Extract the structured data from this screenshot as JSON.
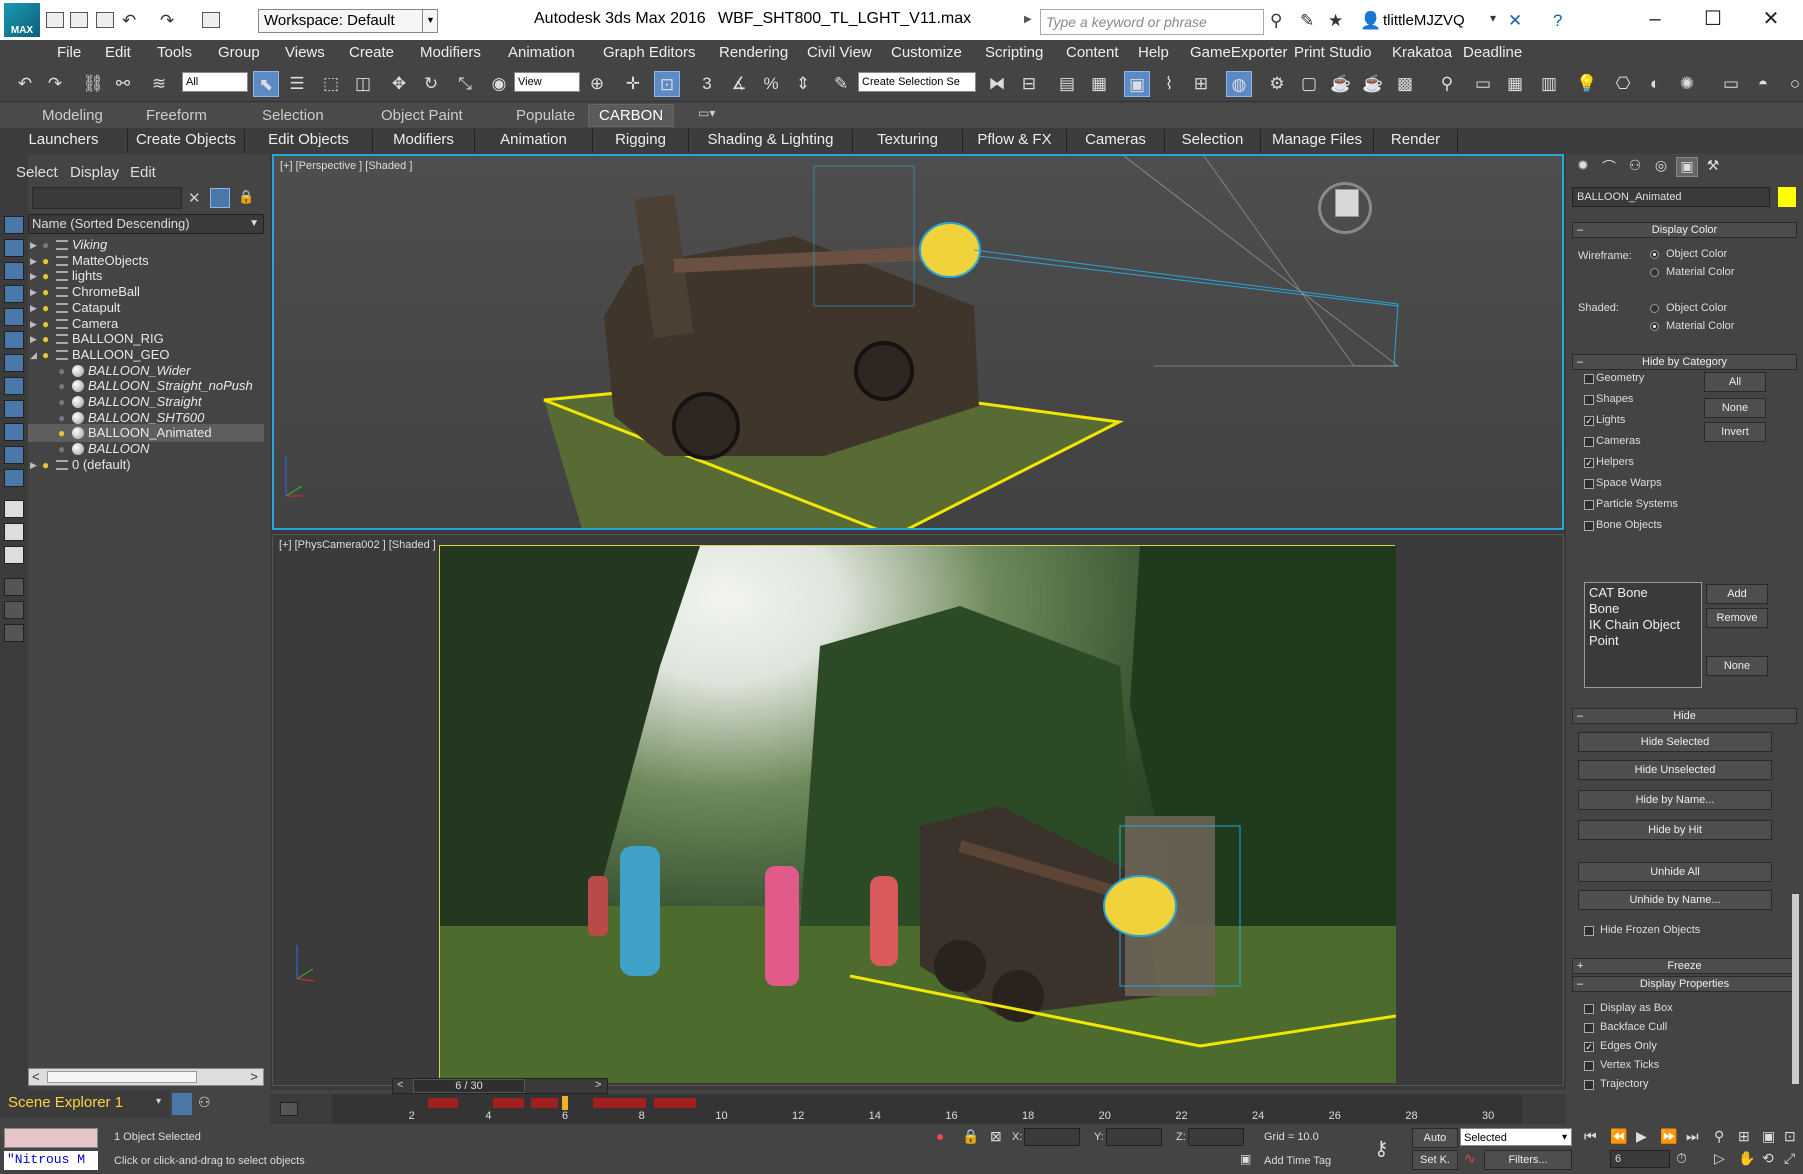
{
  "titlebar": {
    "app_title": "Autodesk 3ds Max 2016",
    "file_title": "WBF_SHT800_TL_LGHT_V11.max",
    "workspace": "Workspace: Default",
    "search_placeholder": "Type a keyword or phrase",
    "user": "tlittleMJZVQ",
    "logo_text": "MAX"
  },
  "menubar": [
    "File",
    "Edit",
    "Tools",
    "Group",
    "Views",
    "Create",
    "Modifiers",
    "Animation",
    "Graph Editors",
    "Rendering",
    "Civil View",
    "Customize",
    "Scripting",
    "Content",
    "Help",
    "GameExporter",
    "Print Studio",
    "Krakatoa",
    "Deadline"
  ],
  "toolbar": {
    "selection_filter": "All",
    "ref_coord": "View",
    "named_selection": "Create Selection Se"
  },
  "ribbon_tabs": [
    "Modeling",
    "Freeform",
    "Selection",
    "Object Paint",
    "Populate",
    "CARBON"
  ],
  "subtabs": [
    "Launchers",
    "Create Objects",
    "Edit Objects",
    "Modifiers",
    "Animation",
    "Rigging",
    "Shading & Lighting",
    "Texturing",
    "Pflow & FX",
    "Cameras",
    "Selection",
    "Manage Files",
    "Render"
  ],
  "scene_explorer": {
    "menu": [
      "Select",
      "Display",
      "Edit"
    ],
    "column_header": "Name (Sorted Descending)",
    "rows": [
      {
        "label": "Viking",
        "level": 0,
        "type": "layer",
        "bulb": "off",
        "arrow": "right",
        "italic": true,
        "selected": false
      },
      {
        "label": "MatteObjects",
        "level": 0,
        "type": "layer",
        "bulb": "on",
        "arrow": "right",
        "italic": false,
        "selected": false
      },
      {
        "label": "lights",
        "level": 0,
        "type": "layer",
        "bulb": "on",
        "arrow": "right",
        "italic": false,
        "selected": false
      },
      {
        "label": "ChromeBall",
        "level": 0,
        "type": "layer",
        "bulb": "on",
        "arrow": "right",
        "italic": false,
        "selected": false
      },
      {
        "label": "Catapult",
        "level": 0,
        "type": "layer",
        "bulb": "on",
        "arrow": "right",
        "italic": false,
        "selected": false
      },
      {
        "label": "Camera",
        "level": 0,
        "type": "layer",
        "bulb": "on",
        "arrow": "right",
        "italic": false,
        "selected": false
      },
      {
        "label": "BALLOON_RIG",
        "level": 0,
        "type": "layer",
        "bulb": "on",
        "arrow": "right",
        "italic": false,
        "selected": false
      },
      {
        "label": "BALLOON_GEO",
        "level": 0,
        "type": "layer",
        "bulb": "on",
        "arrow": "down",
        "italic": false,
        "selected": false
      },
      {
        "label": "BALLOON_Wider",
        "level": 1,
        "type": "object",
        "bulb": "off",
        "arrow": "",
        "italic": true,
        "selected": false
      },
      {
        "label": "BALLOON_Straight_noPush",
        "level": 1,
        "type": "object",
        "bulb": "off",
        "arrow": "",
        "italic": true,
        "selected": false
      },
      {
        "label": "BALLOON_Straight",
        "level": 1,
        "type": "object",
        "bulb": "off",
        "arrow": "",
        "italic": true,
        "selected": false
      },
      {
        "label": "BALLOON_SHT600",
        "level": 1,
        "type": "object",
        "bulb": "off",
        "arrow": "",
        "italic": true,
        "selected": false
      },
      {
        "label": "BALLOON_Animated",
        "level": 1,
        "type": "object",
        "bulb": "on",
        "arrow": "",
        "italic": false,
        "selected": true
      },
      {
        "label": "BALLOON",
        "level": 1,
        "type": "object",
        "bulb": "off",
        "arrow": "",
        "italic": true,
        "selected": false
      },
      {
        "label": "0 (default)",
        "level": 0,
        "type": "layer",
        "bulb": "on",
        "arrow": "right",
        "italic": false,
        "selected": false
      }
    ],
    "explorer_name": "Scene Explorer 1"
  },
  "viewports": {
    "top_label": "[+] [Perspective ] [Shaded ]",
    "bottom_label": "[+] [PhysCamera002 ] [Shaded ]"
  },
  "command_panel": {
    "object_name": "BALLOON_Animated",
    "object_color": "#ffff00",
    "display_color": {
      "title": "Display Color",
      "wireframe_label": "Wireframe:",
      "shaded_label": "Shaded:",
      "object_color": "Object Color",
      "material_color": "Material Color"
    },
    "hide_by_category": {
      "title": "Hide by Category",
      "items": [
        {
          "label": "Geometry",
          "checked": false
        },
        {
          "label": "Shapes",
          "checked": false
        },
        {
          "label": "Lights",
          "checked": true
        },
        {
          "label": "Cameras",
          "checked": false
        },
        {
          "label": "Helpers",
          "checked": true
        },
        {
          "label": "Space Warps",
          "checked": false
        },
        {
          "label": "Particle Systems",
          "checked": false
        },
        {
          "label": "Bone Objects",
          "checked": false
        }
      ],
      "buttons": [
        "All",
        "None",
        "Invert"
      ],
      "list": [
        "CAT Bone",
        "Bone",
        "IK Chain Object",
        "Point"
      ],
      "list_buttons": [
        "Add",
        "Remove",
        "None"
      ]
    },
    "hide": {
      "title": "Hide",
      "buttons": [
        "Hide Selected",
        "Hide Unselected",
        "Hide by Name...",
        "Hide by Hit",
        "Unhide All",
        "Unhide by Name..."
      ],
      "frozen": "Hide Frozen Objects"
    },
    "freeze_title": "Freeze",
    "display_properties": {
      "title": "Display Properties",
      "items": [
        {
          "label": "Display as Box",
          "checked": false
        },
        {
          "label": "Backface Cull",
          "checked": false
        },
        {
          "label": "Edges Only",
          "checked": true
        },
        {
          "label": "Vertex Ticks",
          "checked": false
        },
        {
          "label": "Trajectory",
          "checked": false
        }
      ]
    }
  },
  "timeline": {
    "frame_display": "6 / 30",
    "ticks": [
      "2",
      "4",
      "6",
      "8",
      "10",
      "12",
      "14",
      "16",
      "18",
      "20",
      "22",
      "24",
      "26",
      "28",
      "30"
    ]
  },
  "status": {
    "objects_selected": "1 Object Selected",
    "prompt": "Click or click-and-drag to select objects",
    "maxscript": "\"Nitrous M",
    "x_label": "X:",
    "y_label": "Y:",
    "z_label": "Z:",
    "grid": "Grid = 10.0",
    "add_time_tag": "Add Time Tag",
    "auto": "Auto",
    "set_key": "Set K.",
    "key_mode": "Selected",
    "filters": "Filters...",
    "current_frame": "6"
  }
}
